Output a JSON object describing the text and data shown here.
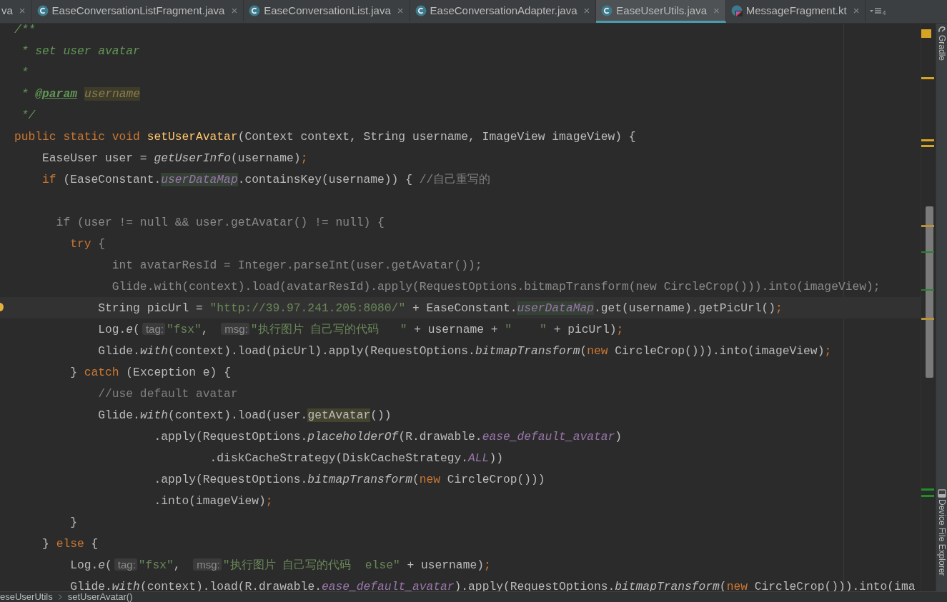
{
  "tabs": [
    {
      "label": "va",
      "selected": false,
      "close": "×"
    },
    {
      "label": "EaseConversationListFragment.java",
      "selected": false,
      "close": "×"
    },
    {
      "label": "EaseConversationList.java",
      "selected": false,
      "close": "×"
    },
    {
      "label": "EaseConversationAdapter.java",
      "selected": false,
      "close": "×"
    },
    {
      "label": "EaseUserUtils.java",
      "selected": true,
      "close": "×"
    },
    {
      "label": "MessageFragment.kt",
      "selected": false,
      "close": "×"
    }
  ],
  "tab_overflow_count": "4",
  "editor": {
    "lines": [
      {
        "current": false,
        "tokens": [
          {
            "kind": "doc",
            "text": "/**"
          }
        ]
      },
      {
        "current": false,
        "tokens": [
          {
            "kind": "doc",
            "text": " * set user avatar"
          }
        ]
      },
      {
        "current": false,
        "tokens": [
          {
            "kind": "doc",
            "text": " *"
          }
        ]
      },
      {
        "current": false,
        "tokens": [
          {
            "kind": "doc",
            "text": " * "
          },
          {
            "kind": "doctag",
            "text": "@param"
          },
          {
            "kind": "docparam",
            "text": "username"
          }
        ]
      },
      {
        "current": false,
        "tokens": [
          {
            "kind": "doc",
            "text": " */"
          }
        ]
      },
      {
        "current": false,
        "tokens": [
          {
            "kind": "keyword",
            "text": "public static void "
          },
          {
            "kind": "decl",
            "text": "setUserAvatar"
          },
          {
            "kind": "plain",
            "text": "(Context context, String username, ImageView imageView) {"
          }
        ]
      },
      {
        "current": false,
        "tokens": [
          {
            "kind": "plain",
            "text": "    EaseUser user = "
          },
          {
            "kind": "static",
            "text": "getUserInfo"
          },
          {
            "kind": "plain",
            "text": "(username)"
          },
          {
            "kind": "keyword",
            "text": ";"
          }
        ]
      },
      {
        "current": false,
        "tokens": [
          {
            "kind": "keyword",
            "text": "    if"
          },
          {
            "kind": "plain",
            "text": " (EaseConstant."
          },
          {
            "kind": "fieldmark",
            "text": "userDataMap"
          },
          {
            "kind": "plain",
            "text": ".containsKey(username)) { "
          },
          {
            "kind": "comment",
            "text": "//自己重写的"
          }
        ]
      },
      {
        "current": false
      },
      {
        "current": false,
        "tokens": [
          {
            "kind": "dim",
            "text": "      if (user != null && user.getAvatar() != null) {"
          }
        ]
      },
      {
        "current": false,
        "tokens": [
          {
            "kind": "keyword",
            "text": "        try"
          },
          {
            "kind": "dim",
            "text": " {"
          }
        ]
      },
      {
        "current": false,
        "tokens": [
          {
            "kind": "dim",
            "text": "              int avatarResId = Integer.parseInt(user.getAvatar());"
          }
        ]
      },
      {
        "current": false,
        "tokens": [
          {
            "kind": "dim",
            "text": "              Glide.with(context).load(avatarResId).apply(RequestOptions.bitmapTransform(new CircleCrop())).into(imageView);"
          }
        ]
      },
      {
        "current": true,
        "tokens": [
          {
            "kind": "plain",
            "text": "            String picUrl = "
          },
          {
            "kind": "string",
            "text": "\"http://39.97.241.205:8080/\""
          },
          {
            "kind": "plain",
            "text": " + EaseConstant."
          },
          {
            "kind": "fieldmark",
            "text": "userDataMap"
          },
          {
            "kind": "plain",
            "text": ".get(username).getPicUrl()"
          },
          {
            "kind": "keyword",
            "text": ";"
          }
        ]
      },
      {
        "current": false,
        "tokens": [
          {
            "kind": "plain",
            "text": "            Log."
          },
          {
            "kind": "static",
            "text": "e"
          },
          {
            "kind": "plain",
            "text": "("
          },
          {
            "kind": "hint",
            "text": "tag:"
          },
          {
            "kind": "string",
            "text": "\"fsx\""
          },
          {
            "kind": "plain",
            "text": ", "
          },
          {
            "kind": "hint",
            "text": "msg:"
          },
          {
            "kind": "string",
            "text": "\"执行图片 自己写的代码   \""
          },
          {
            "kind": "plain",
            "text": " + username + "
          },
          {
            "kind": "string",
            "text": "\"    \""
          },
          {
            "kind": "plain",
            "text": " + picUrl)"
          },
          {
            "kind": "keyword",
            "text": ";"
          }
        ]
      },
      {
        "current": false,
        "tokens": [
          {
            "kind": "plain",
            "text": "            Glide."
          },
          {
            "kind": "static",
            "text": "with"
          },
          {
            "kind": "plain",
            "text": "(context).load(picUrl).apply(RequestOptions."
          },
          {
            "kind": "static",
            "text": "bitmapTransform"
          },
          {
            "kind": "plain",
            "text": "("
          },
          {
            "kind": "keyword",
            "text": "new"
          },
          {
            "kind": "plain",
            "text": " CircleCrop())).into(imageView)"
          },
          {
            "kind": "keyword",
            "text": ";"
          }
        ]
      },
      {
        "current": false,
        "tokens": [
          {
            "kind": "plain",
            "text": "        } "
          },
          {
            "kind": "keyword",
            "text": "catch"
          },
          {
            "kind": "plain",
            "text": " (Exception e) {"
          }
        ]
      },
      {
        "current": false,
        "tokens": [
          {
            "kind": "comment",
            "text": "            //use default avatar"
          }
        ]
      },
      {
        "current": false,
        "tokens": [
          {
            "kind": "plain",
            "text": "            Glide."
          },
          {
            "kind": "static",
            "text": "with"
          },
          {
            "kind": "plain",
            "text": "(context).load(user."
          },
          {
            "kind": "methodmark",
            "text": "getAvatar"
          },
          {
            "kind": "plain",
            "text": "())"
          }
        ]
      },
      {
        "current": false,
        "tokens": [
          {
            "kind": "plain",
            "text": "                    .apply(RequestOptions."
          },
          {
            "kind": "static",
            "text": "placeholderOf"
          },
          {
            "kind": "plain",
            "text": "(R.drawable."
          },
          {
            "kind": "field",
            "text": "ease_default_avatar"
          },
          {
            "kind": "plain",
            "text": ")"
          }
        ]
      },
      {
        "current": false,
        "tokens": [
          {
            "kind": "plain",
            "text": "                            .diskCacheStrategy(DiskCacheStrategy."
          },
          {
            "kind": "field",
            "text": "ALL"
          },
          {
            "kind": "plain",
            "text": "))"
          }
        ]
      },
      {
        "current": false,
        "tokens": [
          {
            "kind": "plain",
            "text": "                    .apply(RequestOptions."
          },
          {
            "kind": "static",
            "text": "bitmapTransform"
          },
          {
            "kind": "plain",
            "text": "("
          },
          {
            "kind": "keyword",
            "text": "new"
          },
          {
            "kind": "plain",
            "text": " CircleCrop()))"
          }
        ]
      },
      {
        "current": false,
        "tokens": [
          {
            "kind": "plain",
            "text": "                    .into(imageView)"
          },
          {
            "kind": "keyword",
            "text": ";"
          }
        ]
      },
      {
        "current": false,
        "tokens": [
          {
            "kind": "plain",
            "text": "        }"
          }
        ]
      },
      {
        "current": false,
        "tokens": [
          {
            "kind": "plain",
            "text": "    } "
          },
          {
            "kind": "keyword",
            "text": "else"
          },
          {
            "kind": "plain",
            "text": " {"
          }
        ]
      },
      {
        "current": false,
        "tokens": [
          {
            "kind": "plain",
            "text": "        Log."
          },
          {
            "kind": "static",
            "text": "e"
          },
          {
            "kind": "plain",
            "text": "("
          },
          {
            "kind": "hint",
            "text": "tag:"
          },
          {
            "kind": "string",
            "text": "\"fsx\""
          },
          {
            "kind": "plain",
            "text": ", "
          },
          {
            "kind": "hint",
            "text": "msg:"
          },
          {
            "kind": "string",
            "text": "\"执行图片 自己写的代码  else\""
          },
          {
            "kind": "plain",
            "text": " + username)"
          },
          {
            "kind": "keyword",
            "text": ";"
          }
        ]
      },
      {
        "current": false,
        "tokens": [
          {
            "kind": "plain",
            "text": "        Glide."
          },
          {
            "kind": "static",
            "text": "with"
          },
          {
            "kind": "plain",
            "text": "(context).load(R.drawable."
          },
          {
            "kind": "field",
            "text": "ease_default_avatar"
          },
          {
            "kind": "plain",
            "text": ").apply(RequestOptions."
          },
          {
            "kind": "static",
            "text": "bitmapTransform"
          },
          {
            "kind": "plain",
            "text": "("
          },
          {
            "kind": "keyword",
            "text": "new"
          },
          {
            "kind": "plain",
            "text": " CircleCrop())).into(ima"
          }
        ]
      }
    ]
  },
  "breadcrumbs": [
    "eseUserUtils",
    "setUserAvatar()"
  ],
  "tool_windows": [
    {
      "label": "Gradle"
    },
    {
      "label": "Device File Explorer"
    }
  ]
}
